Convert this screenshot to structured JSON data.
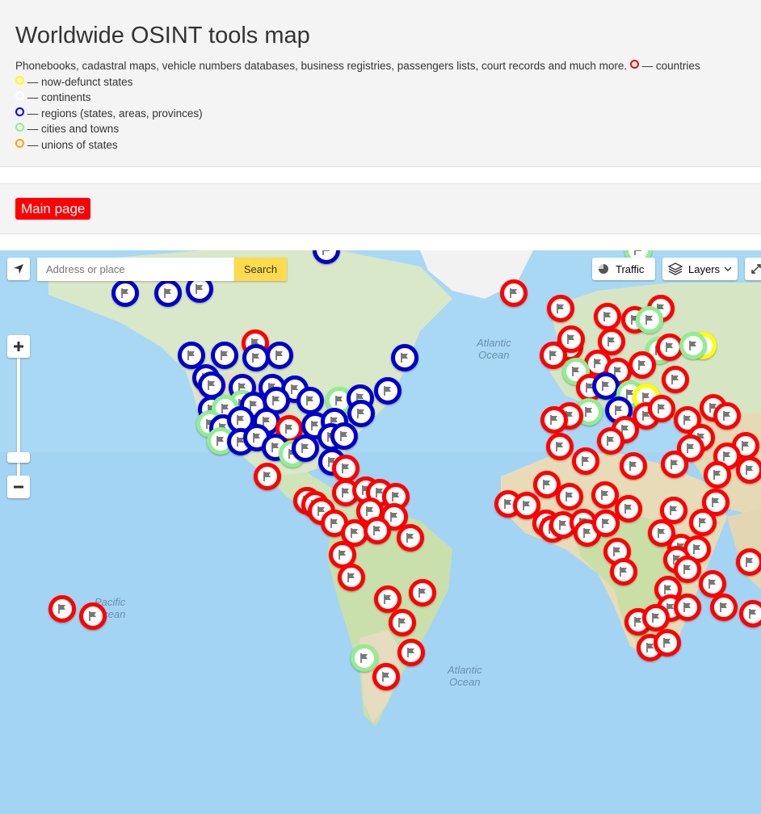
{
  "header": {
    "title": "Worldwide OSINT tools map",
    "description": "Phonebooks, cadastral maps, vehicle numbers databases, business registries, passengers lists, court records and much more.",
    "legend": [
      {
        "label": "— countries",
        "color": "#ff0000"
      },
      {
        "label": "— now-defunct states",
        "color": "#ffff00"
      },
      {
        "label": "— continents",
        "color": "#ffffff"
      },
      {
        "label": "— regions (states, areas, provinces)",
        "color": "#0000ff"
      },
      {
        "label": "— cities and towns",
        "color": "#90ee90"
      },
      {
        "label": "— unions of states",
        "color": "#ffa500"
      }
    ]
  },
  "nav": {
    "main_page_label": "Main page"
  },
  "map": {
    "search_placeholder": "Address or place",
    "search_button": "Search",
    "traffic_label": "Traffic",
    "layers_label": "Layers",
    "ocean_labels": [
      {
        "line1": "Atlantic",
        "line2": "Ocean"
      },
      {
        "line1": "Pacific",
        "line2": "Ocean"
      },
      {
        "line1": "Atlantic",
        "line2": "Ocean"
      }
    ],
    "marker_icon": "flag-icon"
  }
}
